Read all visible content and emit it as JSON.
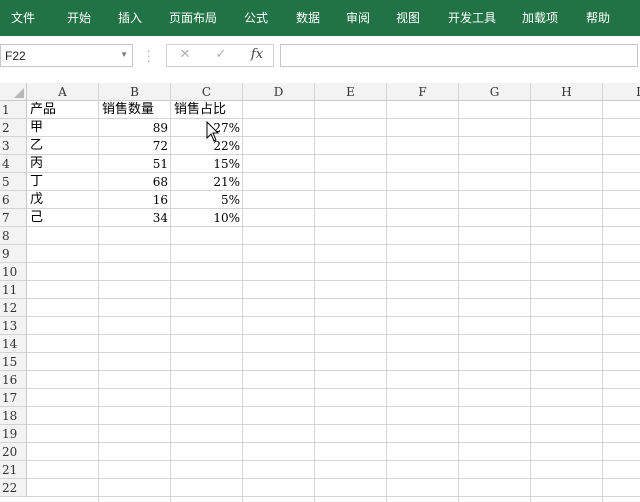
{
  "ribbon": {
    "tabs": [
      "文件",
      "开始",
      "插入",
      "页面布局",
      "公式",
      "数据",
      "审阅",
      "视图",
      "开发工具",
      "加载项",
      "帮助"
    ]
  },
  "formula_bar": {
    "name_box": "F22",
    "cancel_icon": "✕",
    "enter_icon": "✓",
    "fx_label": "fx",
    "formula": ""
  },
  "sheet": {
    "columns": [
      "A",
      "B",
      "C",
      "D",
      "E",
      "F",
      "G",
      "H",
      "I"
    ],
    "rows": [
      "1",
      "2",
      "3",
      "4",
      "5",
      "6",
      "7",
      "8",
      "9",
      "10",
      "11",
      "12",
      "13",
      "14",
      "15",
      "16",
      "17",
      "18",
      "19",
      "20",
      "21",
      "22"
    ],
    "header_row": {
      "a": "产品",
      "b": "销售数量",
      "c": "销售占比"
    },
    "data": [
      {
        "a": "甲",
        "b": "89",
        "c": "27%"
      },
      {
        "a": "乙",
        "b": "72",
        "c": "22%"
      },
      {
        "a": "丙",
        "b": "51",
        "c": "15%"
      },
      {
        "a": "丁",
        "b": "68",
        "c": "21%"
      },
      {
        "a": "戊",
        "b": "16",
        "c": "5%"
      },
      {
        "a": "己",
        "b": "34",
        "c": "10%"
      }
    ]
  },
  "colors": {
    "ribbon_bg": "#217346",
    "header_bg": "#f3f3f3",
    "gridline": "#d4d4d4"
  }
}
